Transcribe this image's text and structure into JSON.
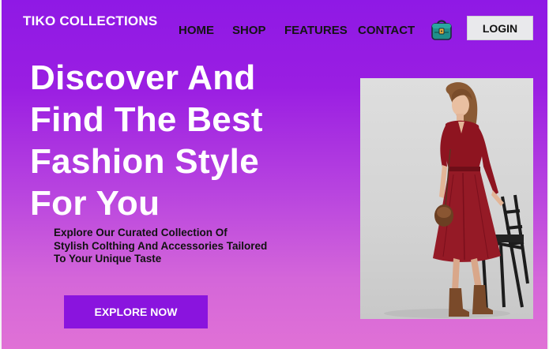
{
  "brand": {
    "name": "TIKO COLLECTIONS"
  },
  "nav": {
    "items": [
      {
        "label": "HOME"
      },
      {
        "label": "SHOP"
      },
      {
        "label": "FEATURES"
      },
      {
        "label": "CONTACT"
      }
    ],
    "cart_icon": "shopping-bag-icon",
    "login_label": "LOGIN"
  },
  "hero": {
    "title_lines": [
      "Discover And",
      "Find The Best",
      "Fashion Style",
      "For You"
    ],
    "subtitle_lines": [
      "Explore Our Curated Collection Of",
      "Stylish Colthing And Accessories Tailored",
      "To Your Unique Taste"
    ],
    "cta_label": "EXPLORE NOW",
    "image": "model-in-red-dress-photo"
  },
  "colors": {
    "gradient_top": "#8f19e5",
    "gradient_bottom": "#e071d6",
    "cta_bg": "#8a14de",
    "login_bg": "#e9e9ec",
    "bag_icon": "#1f8f8a",
    "dress": "#8e1420"
  }
}
